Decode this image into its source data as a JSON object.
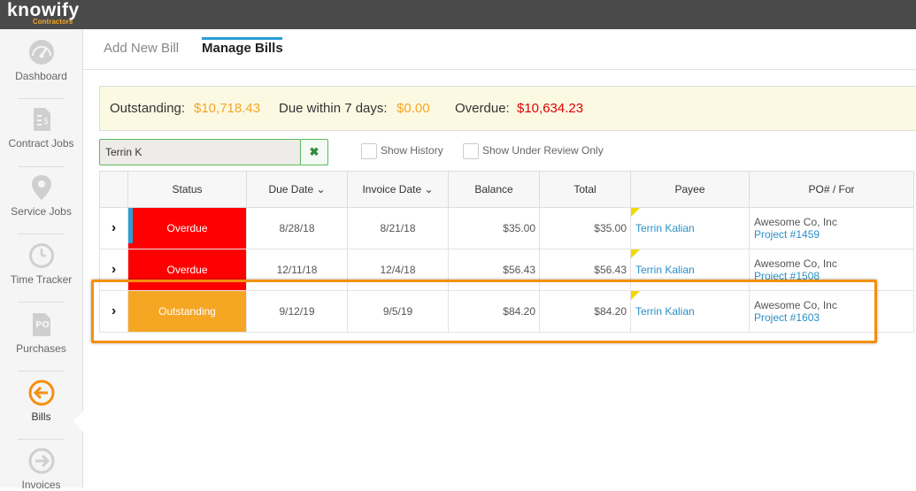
{
  "app": {
    "logo": "knowify",
    "logo_sub": "Contractors"
  },
  "sidebar": {
    "items": [
      {
        "label": "Dashboard",
        "icon": "dashboard-gauge-icon"
      },
      {
        "label": "Contract Jobs",
        "icon": "document-dollar-icon"
      },
      {
        "label": "Service Jobs",
        "icon": "map-pin-icon"
      },
      {
        "label": "Time Tracker",
        "icon": "clock-icon"
      },
      {
        "label": "Purchases",
        "icon": "po-document-icon"
      },
      {
        "label": "Bills",
        "icon": "arrow-left-circle-icon",
        "active": true
      },
      {
        "label": "Invoices",
        "icon": "arrow-right-circle-icon"
      }
    ]
  },
  "tabs": [
    {
      "label": "Add New Bill",
      "active": false
    },
    {
      "label": "Manage Bills",
      "active": true
    }
  ],
  "summary": {
    "outstanding_label": "Outstanding:",
    "outstanding_value": "$10,718.43",
    "due_label": "Due within 7 days:",
    "due_value": "$0.00",
    "overdue_label": "Overdue:",
    "overdue_value": "$10,634.23",
    "colors": {
      "outstanding": "#f5a623",
      "due": "#f5a623",
      "overdue": "#e00000"
    }
  },
  "search": {
    "value": "Terrin K",
    "clear_icon": "close-x-icon"
  },
  "filters": {
    "show_history": "Show History",
    "show_under_review": "Show Under Review Only"
  },
  "table": {
    "headers": [
      "",
      "Status",
      "Due Date",
      "Invoice Date",
      "Balance",
      "Total",
      "Payee",
      "PO# / For"
    ],
    "sort_icon": "chevron-down-icon",
    "rows": [
      {
        "status": "Overdue",
        "status_color": "#ff0000",
        "due_date": "8/28/18",
        "invoice_date": "8/21/18",
        "balance": "$35.00",
        "total": "$35.00",
        "payee": "Terrin Kalian",
        "company": "Awesome Co, Inc",
        "project": "Project #1459"
      },
      {
        "status": "Overdue",
        "status_color": "#ff0000",
        "due_date": "12/11/18",
        "invoice_date": "12/4/18",
        "balance": "$56.43",
        "total": "$56.43",
        "payee": "Terrin Kalian",
        "company": "Awesome Co, Inc",
        "project": "Project #1508"
      },
      {
        "status": "Outstanding",
        "status_color": "#f5a623",
        "due_date": "9/12/19",
        "invoice_date": "9/5/19",
        "balance": "$84.20",
        "total": "$84.20",
        "payee": "Terrin Kalian",
        "company": "Awesome Co, Inc",
        "project": "Project #1603"
      }
    ]
  }
}
